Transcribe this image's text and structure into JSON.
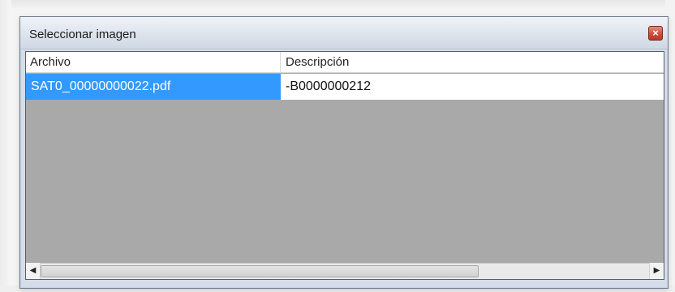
{
  "dialog": {
    "title": "Seleccionar imagen",
    "close_glyph": "×"
  },
  "list": {
    "columns": [
      "Archivo",
      "Descripción"
    ],
    "rows": [
      {
        "archivo": "SAT0_00000000022.pdf",
        "descripcion": "-B0000000212",
        "selected": true
      }
    ]
  },
  "scrollbar": {
    "left_glyph": "◀",
    "right_glyph": "▶",
    "thumb_fraction": 0.72
  },
  "colors": {
    "selection": "#3399ff",
    "list_background": "#a9a9a9"
  }
}
